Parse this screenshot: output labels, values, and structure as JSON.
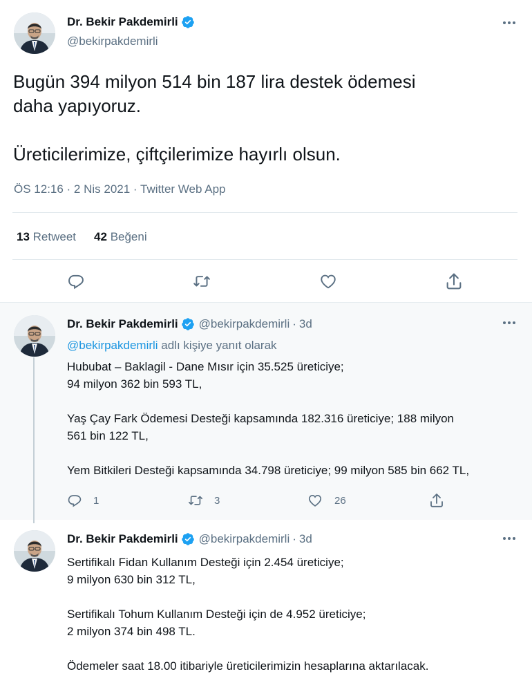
{
  "main": {
    "author": {
      "name": "Dr. Bekir Pakdemirli",
      "handle": "@bekirpakdemirli"
    },
    "text": "Bugün 394 milyon 514 bin 187 lira destek ödemesi\ndaha yapıyoruz.\n\nÜreticilerimize, çiftçilerimize hayırlı olsun.",
    "meta": "ÖS 12:16 · 2 Nis 2021 · Twitter Web App",
    "stats": {
      "retweets_count": "13",
      "retweets_label": "Retweet",
      "likes_count": "42",
      "likes_label": "Beğeni"
    },
    "actions": [
      "reply-icon",
      "retweet-icon",
      "like-icon",
      "share-icon"
    ]
  },
  "replies": [
    {
      "author": {
        "name": "Dr. Bekir Pakdemirli",
        "handle": "@bekirpakdemirli"
      },
      "time": "3d",
      "separator": "·",
      "replying_to_handle": "@bekirpakdemirli",
      "replying_to_suffix": " adlı kişiye yanıt olarak",
      "text": "Hububat – Baklagil - Dane Mısır için 35.525 üreticiye;\n94 milyon 362 bin 593 TL,\n\nYaş Çay Fark Ödemesi Desteği kapsamında 182.316 üreticiye; 188 milyon\n561 bin 122 TL,\n\nYem Bitkileri Desteği kapsamında 34.798 üreticiye; 99 milyon 585 bin 662 TL,",
      "counts": {
        "replies": "1",
        "retweets": "3",
        "likes": "26"
      }
    },
    {
      "author": {
        "name": "Dr. Bekir Pakdemirli",
        "handle": "@bekirpakdemirli"
      },
      "time": "3d",
      "separator": "·",
      "text": "Sertifikalı Fidan Kullanım Desteği için 2.454 üreticiye;\n9 milyon 630 bin 312 TL,\n\nSertifikalı Tohum Kullanım Desteği için de 4.952 üreticiye;\n2 milyon 374 bin 498 TL.\n\nÖdemeler saat 18.00 itibariyle üreticilerimizin hesaplarına aktarılacak."
    }
  ],
  "colors": {
    "verified": "#1da1f2",
    "link": "#1b95e0",
    "secondary_text": "#5b7083",
    "divider": "#e1e8ed",
    "reply_bg": "#f7f9fa"
  }
}
